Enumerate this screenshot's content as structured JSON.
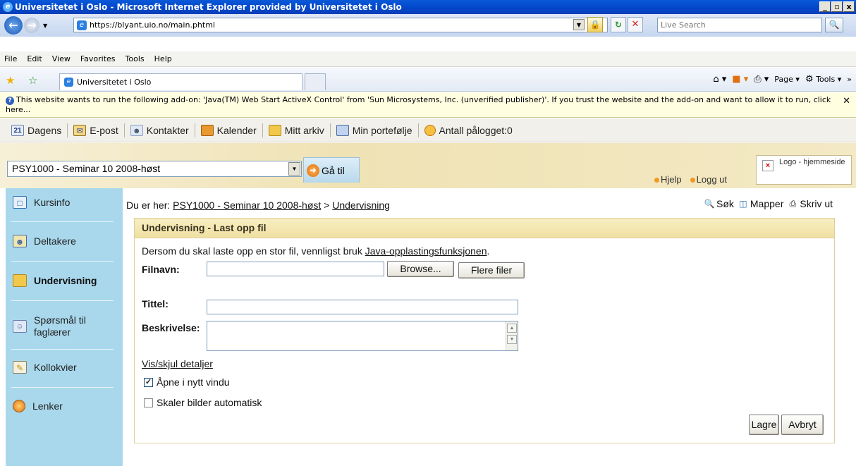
{
  "window": {
    "title": "Universitetet i Oslo - Microsoft Internet Explorer provided by Universitetet i Oslo",
    "controls": [
      "_",
      "▫",
      "x"
    ]
  },
  "address_bar": {
    "url": "https://blyant.uio.no/main.phtml",
    "search_placeholder": "Live Search"
  },
  "menu": [
    "File",
    "Edit",
    "View",
    "Favorites",
    "Tools",
    "Help"
  ],
  "tabs": [
    {
      "label": "Universitetet i Oslo"
    }
  ],
  "command_bar": {
    "page": "Page",
    "tools": "Tools"
  },
  "infobar": {
    "text": "This website wants to run the following add-on: 'Java(TM) Web Start ActiveX Control' from 'Sun Microsystems, Inc. (unverified publisher)'. If you trust the website and the add-on and want to allow it to run, click here..."
  },
  "app_toolbar": {
    "dagens": "Dagens",
    "epost": "E-post",
    "kontakter": "Kontakter",
    "kalender": "Kalender",
    "mitt_arkiv": "Mitt arkiv",
    "min_portefolje": "Min portefølje",
    "antall": "Antall pålogget:0"
  },
  "course": {
    "selected": "PSY1000 - Seminar 10  2008-høst",
    "goto": "Gå til",
    "help": "Hjelp",
    "logout": "Logg ut",
    "logo_alt": "Logo - hjemmeside"
  },
  "sidebar": {
    "items": [
      {
        "label": "Kursinfo"
      },
      {
        "label": "Deltakere"
      },
      {
        "label": "Undervisning"
      },
      {
        "label": "Spørsmål til faglærer"
      },
      {
        "label": "Kollokvier"
      },
      {
        "label": "Lenker"
      }
    ]
  },
  "breadcrumb": {
    "prefix": "Du er her:",
    "course": "PSY1000 - Seminar 10 2008-høst",
    "sep": ">",
    "current": "Undervisning"
  },
  "tools": {
    "search": "Søk",
    "folders": "Mapper",
    "print": "Skriv ut"
  },
  "form": {
    "title": "Undervisning - Last opp fil",
    "hint_prefix": "Dersom du skal laste opp en stor fil, vennligst bruk",
    "hint_link": "Java-opplastingsfunksjonen",
    "hint_suffix": ".",
    "filename_label": "Filnavn:",
    "browse": "Browse...",
    "more_files": "Flere filer",
    "title_label": "Tittel:",
    "description_label": "Beskrivelse:",
    "toggle_details": "Vis/skjul detaljer",
    "open_new_window": "Åpne i nytt vindu",
    "open_new_window_checked": true,
    "scale_images": "Skaler bilder automatisk",
    "scale_images_checked": false,
    "save": "Lagre",
    "cancel": "Avbryt"
  }
}
